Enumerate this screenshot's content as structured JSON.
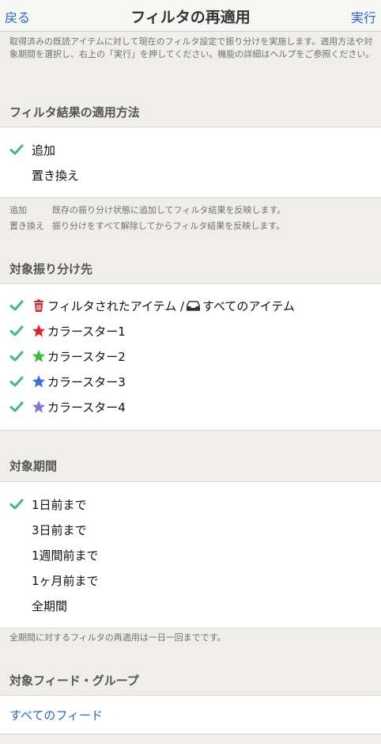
{
  "navbar": {
    "back_label": "戻る",
    "title": "フィルタの再適用",
    "run_label": "実行"
  },
  "intro_note": "取得済みの既読アイテムに対して現在のフィルタ設定で振り分けを実施します。適用方法や対象期間を選択し、右上の「実行」を押してください。機能の詳細はヘルプをご参照ください。",
  "apply_method": {
    "title": "フィルタ結果の適用方法",
    "options": [
      {
        "label": "追加",
        "checked": true
      },
      {
        "label": "置き換え",
        "checked": false
      }
    ],
    "definitions": [
      {
        "term": "追加",
        "text": "既存の振り分け状態に追加してフィルタ結果を反映します。"
      },
      {
        "term": "置き換え",
        "text": "振り分けをすべて解除してからフィルタ結果を反映します。"
      }
    ]
  },
  "targets": {
    "title": "対象振り分け先",
    "filtered_label": "フィルタされたアイテム",
    "separator": "/",
    "all_items_label": "すべてのアイテム",
    "stars": [
      {
        "label": "カラースター1",
        "color": "#e0222e",
        "checked": true
      },
      {
        "label": "カラースター2",
        "color": "#3cbc3c",
        "checked": true
      },
      {
        "label": "カラースター3",
        "color": "#3a6fe0",
        "checked": true
      },
      {
        "label": "カラースター4",
        "color": "#8a70d8",
        "checked": true
      }
    ],
    "trash_color": "#c0262b",
    "check_color": "#45b97c"
  },
  "period": {
    "title": "対象期間",
    "options": [
      {
        "label": "1日前まで",
        "checked": true
      },
      {
        "label": "3日前まで",
        "checked": false
      },
      {
        "label": "1週間前まで",
        "checked": false
      },
      {
        "label": "1ヶ月前まで",
        "checked": false
      },
      {
        "label": "全期間",
        "checked": false
      }
    ],
    "note": "全期間に対するフィルタの再適用は一日一回までです。"
  },
  "feed_group": {
    "title": "対象フィード・グループ",
    "value": "すべてのフィード"
  }
}
